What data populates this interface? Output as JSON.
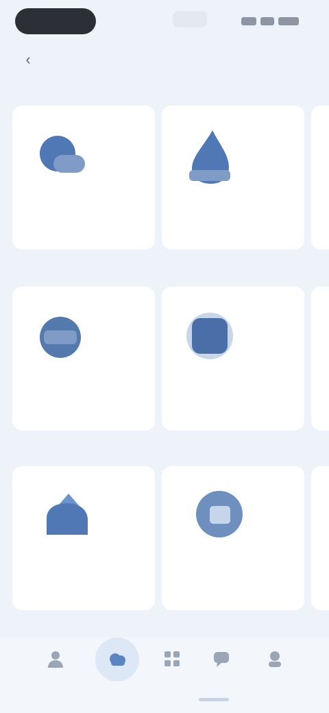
{
  "status_bar": {
    "time": "",
    "center": ""
  },
  "nav": {
    "title": "",
    "action": ""
  },
  "sections": [
    {
      "title": "",
      "cards": [
        {
          "icon": "cloud-icon",
          "name": "",
          "sub": ""
        },
        {
          "icon": "drop-icon",
          "name": "",
          "sub": ""
        },
        {
          "icon": "document-icon",
          "name": "",
          "sub": ""
        }
      ]
    },
    {
      "title": "",
      "cards": [
        {
          "icon": "drive-icon",
          "name": "",
          "sub": ""
        },
        {
          "icon": "calendar-icon",
          "name": "",
          "sub": ""
        },
        {
          "icon": "folder-icon",
          "name": "",
          "sub": ""
        }
      ]
    },
    {
      "title": "",
      "cards": [
        {
          "icon": "home-icon",
          "name": "",
          "sub": ""
        },
        {
          "icon": "gallery-icon",
          "name": "",
          "sub": ""
        },
        {
          "icon": "music-icon",
          "name": "",
          "sub": ""
        }
      ]
    }
  ],
  "tab_section_label": "",
  "tabs": [
    {
      "icon": "person-icon",
      "label": ""
    },
    {
      "icon": "cloud-icon",
      "label": "",
      "active": true
    },
    {
      "icon": "grid-icon",
      "label": ""
    },
    {
      "icon": "chat-icon",
      "label": ""
    },
    {
      "icon": "user-icon",
      "label": ""
    }
  ],
  "colors": {
    "background": "#eef3fa",
    "card": "#ffffff",
    "accent": "#5b84c2",
    "icon_primary": "#4f78b4",
    "icon_secondary": "#7f9cc7"
  }
}
